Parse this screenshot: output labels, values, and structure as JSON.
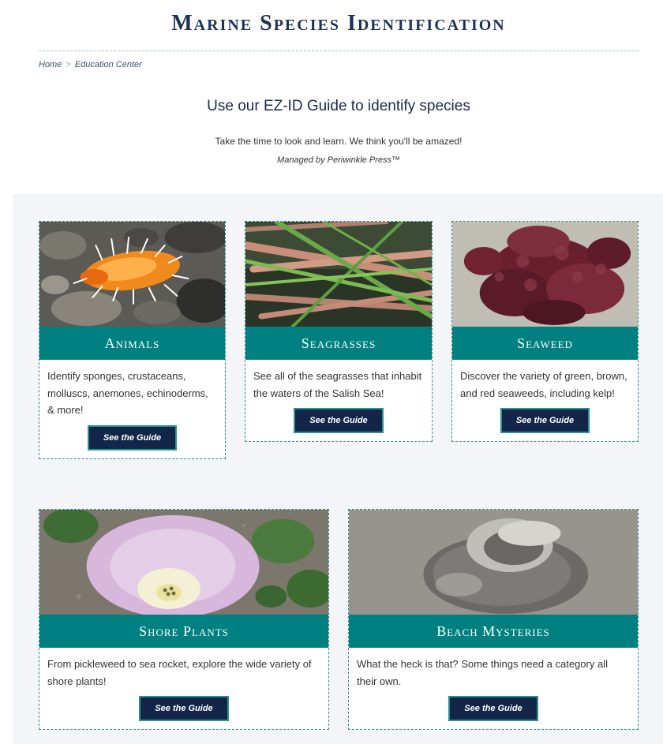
{
  "site_title": "Marine Species Identification",
  "breadcrumb": {
    "home": "Home",
    "separator": ">",
    "current": "Education Center"
  },
  "intro": {
    "headline": "Use our EZ-ID Guide to identify species",
    "tagline": "Take the time to look and learn. We think you'll be amazed!",
    "managed_by": "Managed by Periwinkle Press™"
  },
  "cards": [
    {
      "title": "Animals",
      "description": "Identify sponges, crustaceans, molluscs, anemones, echinoderms, & more!",
      "button": "See the Guide",
      "photo": "nudibranch-photo"
    },
    {
      "title": "Seagrasses",
      "description": "See all of the seagrasses that inhabit the waters of the Salish Sea!",
      "button": "See the Guide",
      "photo": "seagrass-photo"
    },
    {
      "title": "Seaweed",
      "description": "Discover the variety of green, brown, and red seaweeds, including kelp!",
      "button": "See the Guide",
      "photo": "red-seaweed-photo"
    },
    {
      "title": "Shore Plants",
      "description": "From pickleweed to sea rocket, explore the wide variety of shore plants!",
      "button": "See the Guide",
      "photo": "beach-morning-glory-photo"
    },
    {
      "title": "Beach Mysteries",
      "description": "What the heck is that? Some things need a category all their own.",
      "button": "See the Guide",
      "photo": "moon-snail-collar-photo"
    }
  ],
  "colors": {
    "accent": "#008080",
    "button_bg": "#14254a",
    "title": "#1b3355",
    "panel_bg": "#f3f5f9"
  }
}
